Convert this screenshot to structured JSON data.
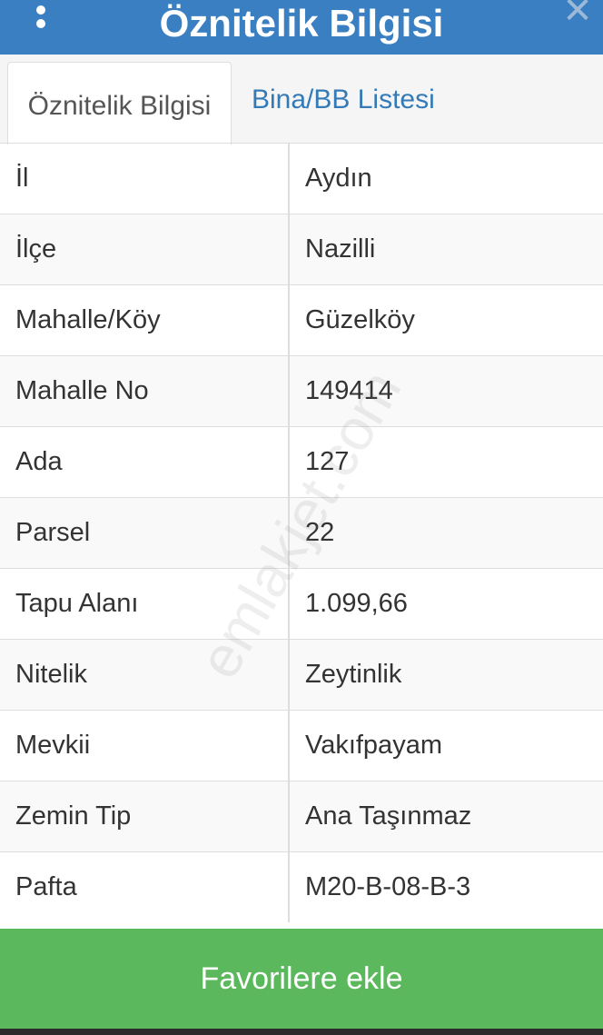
{
  "header": {
    "title": "Öznitelik Bilgisi",
    "menu_icon": "kebab-menu-icon",
    "close_icon": "close-icon"
  },
  "tabs": [
    {
      "label": "Öznitelik Bilgisi",
      "active": true
    },
    {
      "label": "Bina/BB Listesi",
      "active": false
    }
  ],
  "rows": [
    {
      "key": "İl",
      "value": "Aydın"
    },
    {
      "key": "İlçe",
      "value": "Nazilli"
    },
    {
      "key": "Mahalle/Köy",
      "value": "Güzelköy"
    },
    {
      "key": "Mahalle No",
      "value": "149414"
    },
    {
      "key": "Ada",
      "value": "127"
    },
    {
      "key": "Parsel",
      "value": "22"
    },
    {
      "key": "Tapu Alanı",
      "value": "1.099,66"
    },
    {
      "key": "Nitelik",
      "value": "Zeytinlik"
    },
    {
      "key": "Mevkii",
      "value": "Vakıfpayam"
    },
    {
      "key": "Zemin Tip",
      "value": "Ana Taşınmaz"
    },
    {
      "key": "Pafta",
      "value": "M20-B-08-B-3"
    }
  ],
  "watermark": "emlakjet.com",
  "favorite_button": "Favorilere ekle",
  "colors": {
    "header": "#3a7fc1",
    "link": "#337ab7",
    "button": "#5cb85c"
  }
}
